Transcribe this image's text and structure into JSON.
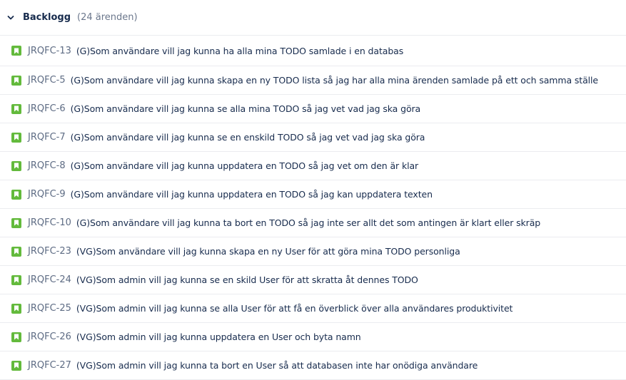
{
  "backlog": {
    "title": "Backlogg",
    "count": "(24 ärenden)",
    "issue_icon": "story-bookmark-icon",
    "icon_color": "#63ba3c",
    "issues": [
      {
        "key": "JRQFC-13",
        "summary": "(G)Som användare vill jag kunna ha alla mina TODO samlade i en databas"
      },
      {
        "key": "JRQFC-5",
        "summary": "(G)Som användare vill jag kunna skapa en ny TODO lista så jag har alla mina ärenden samlade på ett och samma ställe"
      },
      {
        "key": "JRQFC-6",
        "summary": "(G)Som användare vill jag kunna se alla mina TODO så jag vet vad jag ska göra"
      },
      {
        "key": "JRQFC-7",
        "summary": "(G)Som användare vill jag kunna se en enskild TODO så jag vet vad jag ska göra"
      },
      {
        "key": "JRQFC-8",
        "summary": "(G)Som användare vill jag kunna uppdatera en TODO så jag vet om den är klar"
      },
      {
        "key": "JRQFC-9",
        "summary": "(G)Som användare vill jag kunna uppdatera en TODO så jag kan uppdatera texten"
      },
      {
        "key": "JRQFC-10",
        "summary": "(G)Som användare vill jag kunna ta bort en TODO så jag inte ser allt det som antingen är klart eller skräp"
      },
      {
        "key": "JRQFC-23",
        "summary": "(VG)Som användare vill jag kunna skapa en ny User för att göra mina TODO personliga"
      },
      {
        "key": "JRQFC-24",
        "summary": "(VG)Som admin vill jag kunna se en skild User för att skratta åt dennes TODO"
      },
      {
        "key": "JRQFC-25",
        "summary": "(VG)Som admin vill jag kunna se alla User för att få en överblick över alla användares produktivitet"
      },
      {
        "key": "JRQFC-26",
        "summary": "(VG)Som admin vill jag kunna uppdatera en User och byta namn"
      },
      {
        "key": "JRQFC-27",
        "summary": "(VG)Som admin vill jag kunna ta bort en User så att databasen inte har onödiga användare"
      }
    ]
  }
}
